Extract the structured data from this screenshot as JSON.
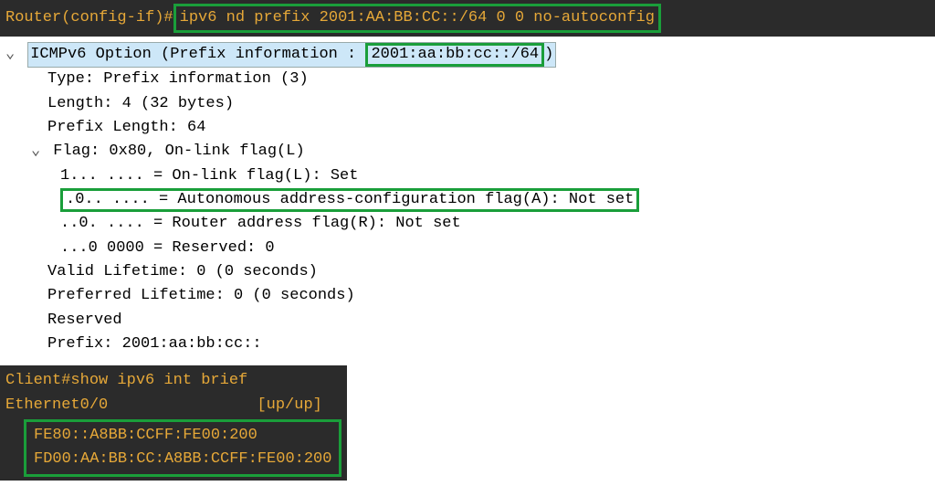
{
  "router": {
    "prompt": "Router(config-if)#",
    "command": "ipv6 nd prefix 2001:AA:BB:CC::/64 0 0 no-autoconfig"
  },
  "packet": {
    "header_prefix": "ICMPv6 Option (Prefix information : ",
    "header_prefix_value": "2001:aa:bb:cc::/64",
    "header_suffix": ")",
    "type_line": "Type: Prefix information (3)",
    "length_line": "Length: 4 (32 bytes)",
    "prefix_len_line": "Prefix Length: 64",
    "flag_header": "Flag: 0x80, On-link flag(L)",
    "flag_onlink": "1... .... = On-link flag(L): Set",
    "flag_auto": ".0.. .... = Autonomous address-configuration flag(A): Not set",
    "flag_router": "..0. .... = Router address flag(R): Not set",
    "flag_reserved": "...0 0000 = Reserved: 0",
    "valid_lifetime": "Valid Lifetime: 0 (0 seconds)",
    "preferred_lifetime": "Preferred Lifetime: 0 (0 seconds)",
    "reserved": "Reserved",
    "prefix": "Prefix: 2001:aa:bb:cc::"
  },
  "client": {
    "command": "Client#show ipv6 int brief",
    "iface_name": "Ethernet0/0",
    "iface_state": "[up/up]",
    "addr1": "FE80::A8BB:CCFF:FE00:200",
    "addr2": "FD00:AA:BB:CC:A8BB:CCFF:FE00:200"
  }
}
